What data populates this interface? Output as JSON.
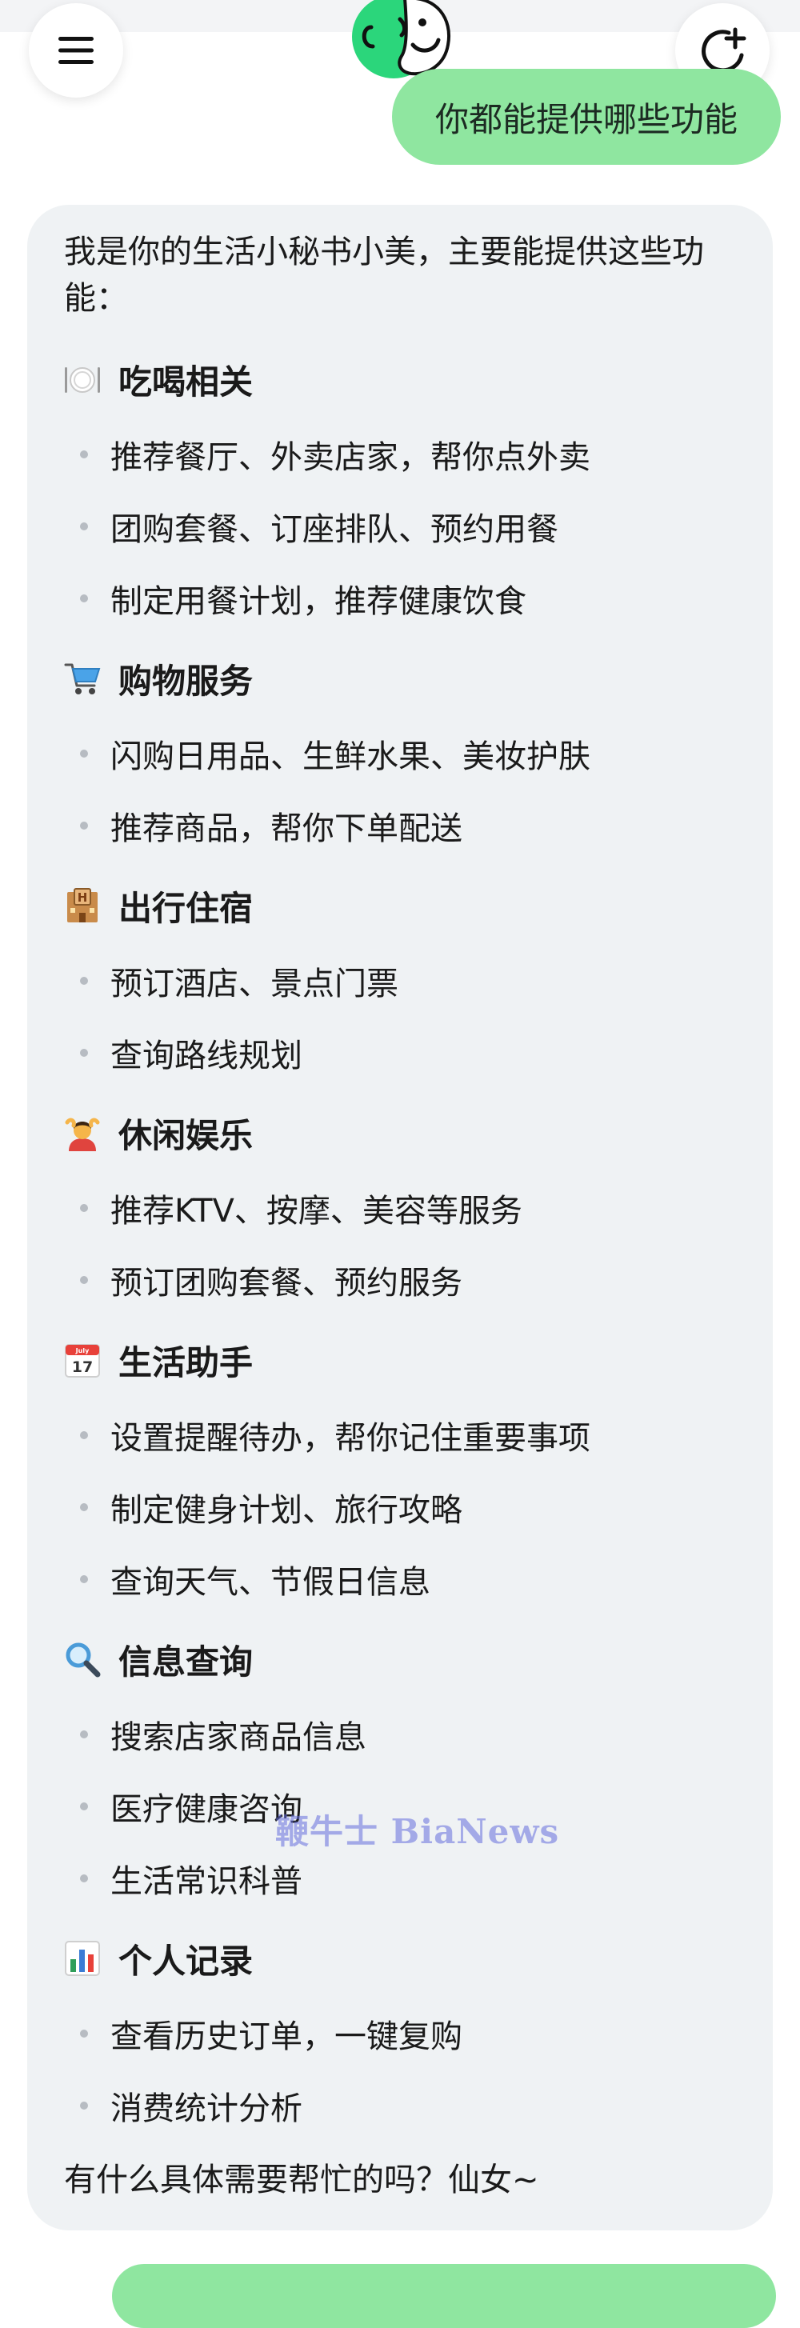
{
  "header": {
    "menu_icon": "hamburger-menu-icon",
    "new_chat_icon": "new-chat-plus-icon",
    "avatar_icon": "assistant-face-avatar"
  },
  "colors": {
    "user_bubble": "#8fe6a0",
    "card_background": "#eff2f4",
    "avatar_green": "#2bd67b",
    "watermark": "#6470dc"
  },
  "user_message": "你都能提供哪些功能",
  "answer": {
    "intro": "我是你的生活小秘书小美，主要能提供这些功能：",
    "sections": [
      {
        "emoji": "fork-knife-plate-icon",
        "title": "吃喝相关",
        "items": [
          "推荐餐厅、外卖店家，帮你点外卖",
          "团购套餐、订座排队、预约用餐",
          "制定用餐计划，推荐健康饮食"
        ]
      },
      {
        "emoji": "shopping-cart-icon",
        "title": "购物服务",
        "items": [
          "闪购日用品、生鲜水果、美妆护肤",
          "推荐商品，帮你下单配送"
        ]
      },
      {
        "emoji": "hotel-icon",
        "title": "出行住宿",
        "items": [
          "预订酒店、景点门票",
          "查询路线规划"
        ]
      },
      {
        "emoji": "massage-icon",
        "title": "休闲娱乐",
        "items": [
          "推荐KTV、按摩、美容等服务",
          "预订团购套餐、预约服务"
        ]
      },
      {
        "emoji": "calendar-icon",
        "title": "生活助手",
        "items": [
          "设置提醒待办，帮你记住重要事项",
          "制定健身计划、旅行攻略",
          "查询天气、节假日信息"
        ]
      },
      {
        "emoji": "magnifier-icon",
        "title": "信息查询",
        "items": [
          "搜索店家商品信息",
          "医疗健康咨询",
          "生活常识科普"
        ]
      },
      {
        "emoji": "bar-chart-icon",
        "title": "个人记录",
        "items": [
          "查看历史订单，一键复购",
          "消费统计分析"
        ]
      }
    ],
    "closing": "有什么具体需要帮忙的吗？仙女~"
  },
  "calendar_badge": {
    "month": "July",
    "day": "17"
  },
  "watermark": "鞭牛士 BiaNews"
}
